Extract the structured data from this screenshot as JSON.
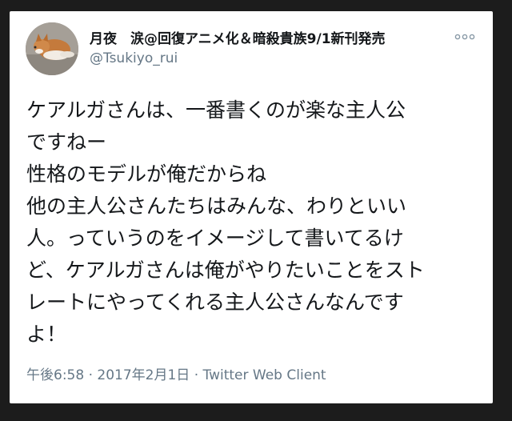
{
  "user": {
    "display_name": "月夜　涙@回復アニメ化＆暗殺貴族9/1新刊発売",
    "handle": "@Tsukiyo_rui"
  },
  "tweet": {
    "lines": [
      "ケアルガさんは、一番書くのが楽な主人公",
      "ですねー",
      "性格のモデルが俺だからね",
      "他の主人公さんたちはみんな、わりといい",
      "人。っていうのをイメージして書いてるけ",
      "ど、ケアルガさんは俺がやりたいことをスト",
      "レートにやってくれる主人公さんなんです",
      "よ！"
    ]
  },
  "meta": {
    "time": "午後6:58",
    "separator1": " · ",
    "date": "2017年2月1日",
    "separator2": " · ",
    "client": "Twitter Web Client"
  },
  "icons": {
    "more": "more-options-icon",
    "avatar": "profile-avatar"
  },
  "colors": {
    "text": "#14171a",
    "secondary": "#657786",
    "background": "#1c1c1c",
    "card": "#ffffff"
  }
}
